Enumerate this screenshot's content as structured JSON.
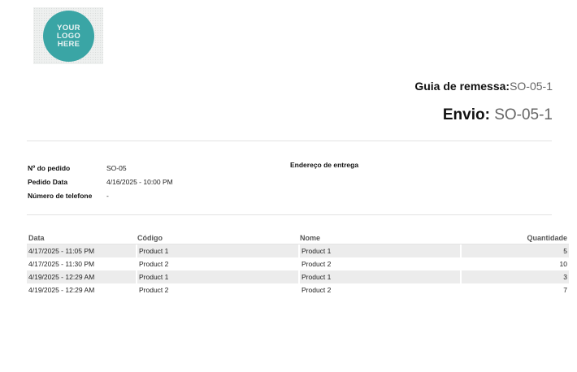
{
  "logo": {
    "lines": [
      "YOUR",
      "LOGO",
      "HERE"
    ]
  },
  "document": {
    "type_label": "Guia de remessa:",
    "type_value": "SO-05-1",
    "shipment_label": "Envio:",
    "shipment_value": "SO-05-1"
  },
  "order_info": [
    {
      "label": "Nº do pedido",
      "value": "SO-05"
    },
    {
      "label": "Pedido Data",
      "value": "4/16/2025 - 10:00 PM"
    },
    {
      "label": "Número de telefone",
      "value": "-"
    }
  ],
  "delivery_address_label": "Endereço de entrega",
  "items_table": {
    "headers": {
      "date": "Data",
      "code": "Código",
      "name": "Nome",
      "quantity": "Quantidade"
    },
    "rows": [
      {
        "date": "4/17/2025 - 11:05 PM",
        "code": "Product 1",
        "name": "Product 1",
        "quantity": "5"
      },
      {
        "date": "4/17/2025 - 11:30 PM",
        "code": "Product 2",
        "name": "Product 2",
        "quantity": "10"
      },
      {
        "date": "4/19/2025 - 12:29 AM",
        "code": "Product 1",
        "name": "Product 1",
        "quantity": "3"
      },
      {
        "date": "4/19/2025 - 12:29 AM",
        "code": "Product 2",
        "name": "Product 2",
        "quantity": "7"
      }
    ]
  }
}
